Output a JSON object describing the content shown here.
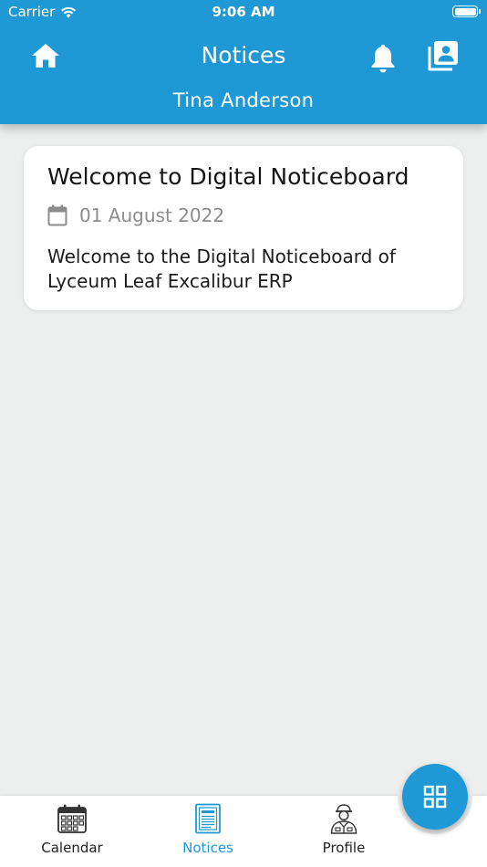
{
  "status_bar": {
    "carrier": "Carrier",
    "time": "9:06 AM"
  },
  "header": {
    "title": "Notices",
    "user_name": "Tina Anderson",
    "background_color": "#1f98d6",
    "icons": {
      "left": "home-icon",
      "right": [
        "bell-icon",
        "contacts-icon"
      ]
    }
  },
  "notices": [
    {
      "title": "Welcome to Digital Noticeboard",
      "date": "01 August 2022",
      "body": "Welcome to the Digital Noticeboard of Lyceum Leaf Excalibur ERP"
    }
  ],
  "tabs": [
    {
      "label": "Calendar",
      "icon": "calendar-icon",
      "active": false
    },
    {
      "label": "Notices",
      "icon": "noticeboard-icon",
      "active": true
    },
    {
      "label": "Profile",
      "icon": "profile-icon",
      "active": false
    }
  ],
  "fab": {
    "icon": "grid-icon"
  },
  "colors": {
    "accent": "#1f98d6",
    "background": "#edeeee",
    "muted_text": "#8c8c8c"
  }
}
